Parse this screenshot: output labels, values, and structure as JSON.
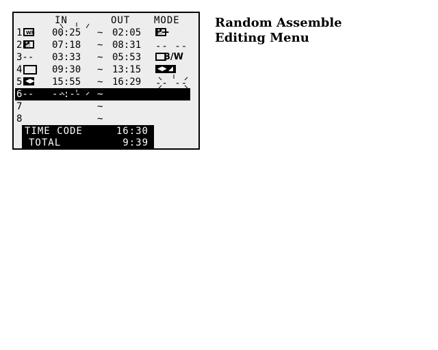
{
  "screen": {
    "headers": {
      "in": "IN",
      "out": "OUT",
      "mode": "MODE"
    },
    "rows": [
      {
        "num": "1",
        "in": "00:25",
        "tilde": "~",
        "out": "02:05",
        "mode_label": "P--"
      },
      {
        "num": "2",
        "in": "07:18",
        "tilde": "~",
        "out": "08:31",
        "mode_label": "-- --"
      },
      {
        "num": "3--",
        "in": "03:33",
        "tilde": "~",
        "out": "05:53",
        "mode_label": "B/W"
      },
      {
        "num": "4",
        "in": "09:30",
        "tilde": "~",
        "out": "13:15",
        "mode_label": ""
      },
      {
        "num": "5",
        "in": "15:55",
        "tilde": "~",
        "out": "16:29",
        "mode_label": "-- --"
      },
      {
        "num": "6--",
        "in": "--:--",
        "tilde": "~",
        "out": "",
        "mode_label": ""
      },
      {
        "num": "7",
        "in": "",
        "tilde": "~",
        "out": "",
        "mode_label": ""
      },
      {
        "num": "8",
        "in": "",
        "tilde": "~",
        "out": "",
        "mode_label": ""
      }
    ],
    "time_code_label": "TIME CODE",
    "time_code_value": "16:30",
    "total_label": "TOTAL",
    "total_value": "9:39",
    "icons": {
      "row1_fade": "Wh",
      "row2_fade": "P",
      "row1_mode_icon": "wipe-icon",
      "row4_mode_icon": "wipe-split-icon",
      "row5_fade_icon": "wipe-split-icon"
    }
  },
  "caption": {
    "line1": "Random Assemble",
    "line2": "Editing Menu"
  }
}
